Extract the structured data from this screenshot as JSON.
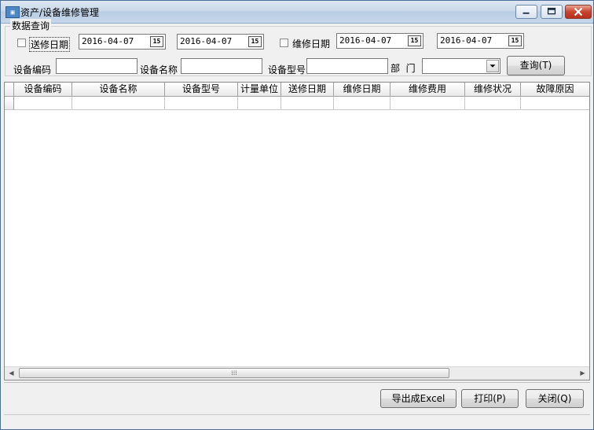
{
  "window": {
    "title": "资产/设备维修管理",
    "icon": "app-icon"
  },
  "query": {
    "group_title": "数据查询",
    "send_date": {
      "label": "送修日期",
      "checked": false,
      "from": "2016-04-07",
      "to": "2016-04-07"
    },
    "repair_date": {
      "label": "维修日期",
      "checked": false,
      "from": "2016-04-07",
      "to": "2016-04-07"
    },
    "calendar_glyph": "15",
    "fields": {
      "code_label": "设备编码",
      "code_value": "",
      "name_label": "设备名称",
      "name_value": "",
      "model_label": "设备型号",
      "model_value": "",
      "dept_label": "部  门",
      "dept_value": ""
    },
    "search_button": "查询(T)"
  },
  "grid": {
    "columns": [
      "设备编码",
      "设备名称",
      "设备型号",
      "计量单位",
      "送修日期",
      "维修日期",
      "维修费用",
      "维修状况",
      "故障原因"
    ],
    "rows": [
      [
        "",
        "",
        "",
        "",
        "",
        "",
        "",
        "",
        ""
      ]
    ],
    "scroll_thumb_glyph": "⁞⁞⁞"
  },
  "actions": {
    "export_label": "导出成Excel",
    "print_label": "打印(P)",
    "close_label": "关闭(Q)"
  },
  "colors": {
    "titlebar": "#c9d8ea",
    "close_button": "#c8452d",
    "window_bg": "#f0f0f0"
  }
}
